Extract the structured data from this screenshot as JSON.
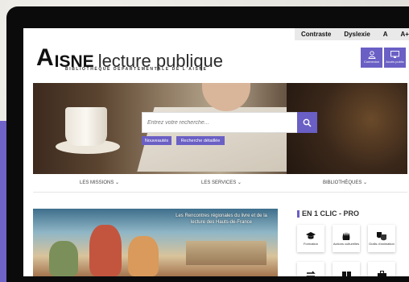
{
  "utility": {
    "items": [
      "Contraste",
      "Dyslexie",
      "A",
      "A+"
    ]
  },
  "brand": {
    "a": "A",
    "isne": "ISNE",
    "lecture": "lecture publique",
    "tagline": "BIBLIOTHÈQUE DÉPARTEMENTALE DE L'AISNE"
  },
  "header_buttons": {
    "connexion": "Connexion",
    "acces": "Accès public"
  },
  "search": {
    "placeholder": "Entrez votre recherche...",
    "chip_new": "Nouveautés",
    "chip_adv": "Recherche détaillée"
  },
  "nav": {
    "items": [
      "LES MISSIONS ⌄",
      "LES SERVICES ⌄",
      "BIBLIOTHÈQUES ⌄"
    ]
  },
  "article": {
    "title": "Les Rencontres régionales du livre et de la lecture des Hauts-de-France"
  },
  "sidebar": {
    "title": "EN 1 CLIC - PRO",
    "tiles": [
      "Formation",
      "Actions culturelles",
      "Outils d'animation",
      "",
      "",
      ""
    ]
  },
  "colors": {
    "accent": "#6a5fc4"
  }
}
